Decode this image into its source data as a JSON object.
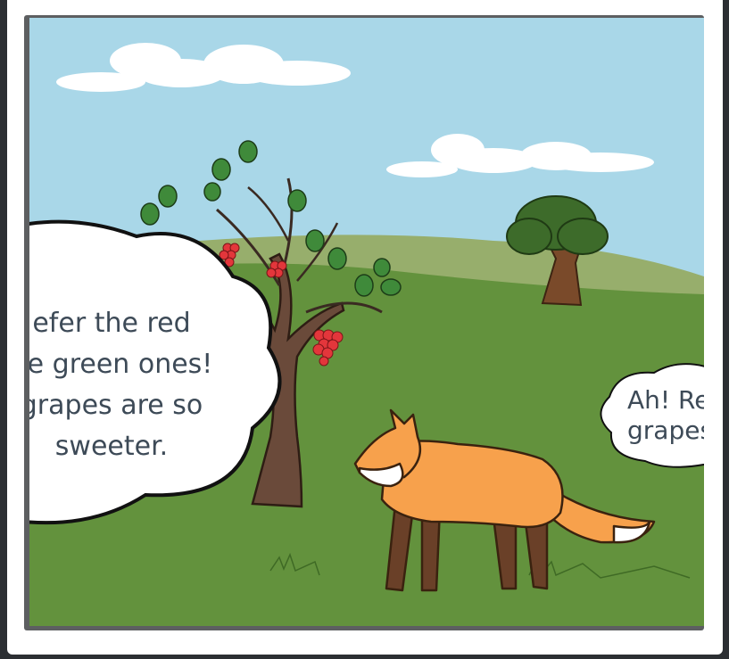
{
  "left_bubble": {
    "lines": [
      "efer the red",
      "he green ones!",
      "grapes are so",
      "sweeter."
    ]
  },
  "right_bubble": {
    "lines": [
      "Ah! Re",
      "grapes"
    ]
  },
  "colors": {
    "sky": "#a9d7e8",
    "grass": "#63923d",
    "far_hill": "#97ae6c",
    "fox_orange": "#f7a14c",
    "grape_red": "#e3363b"
  }
}
